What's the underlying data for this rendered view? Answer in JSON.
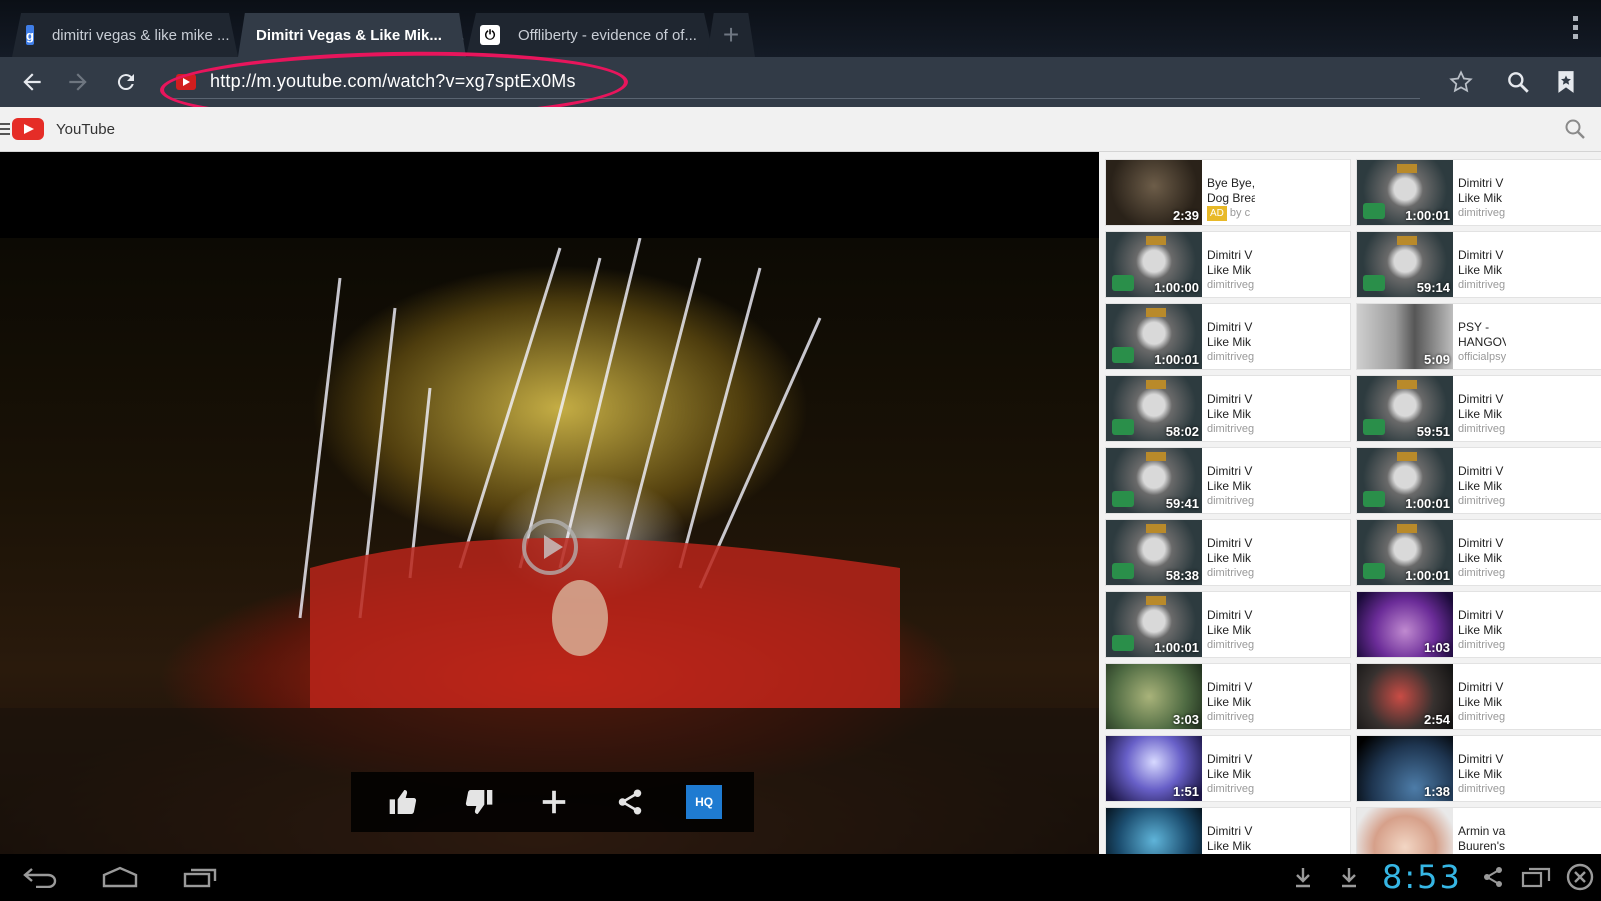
{
  "browser": {
    "tabs": [
      {
        "label": "dimitri vegas & like mike ...",
        "favicon": "google-g-icon",
        "active": false
      },
      {
        "label": "Dimitri Vegas & Like Mik...",
        "favicon": "none",
        "active": true
      },
      {
        "label": "Offliberty - evidence of of...",
        "favicon": "power-icon",
        "active": false
      }
    ],
    "close_glyph": "✕",
    "newtab_glyph": "+",
    "address": "http://m.youtube.com/watch?v=xg7sptEx0Ms",
    "highlight_color": "#e8155c"
  },
  "youtube": {
    "brand": "YouTube",
    "hq_label": "HQ",
    "related": [
      {
        "title": "Bye Bye, Dog Brea",
        "line2": "Dog Brea",
        "channel": "by c",
        "duration": "2:39",
        "ad": "AD",
        "thumb": "pug"
      },
      {
        "title": "Dimitri V",
        "line2": "Like Mik",
        "channel": "dimitriveg",
        "duration": "1:00:01",
        "thumb": "dimitri"
      },
      {
        "title": "Dimitri V",
        "line2": "Like Mik",
        "channel": "dimitriveg",
        "duration": "1:00:00",
        "thumb": "dimitri"
      },
      {
        "title": "Dimitri V",
        "line2": "Like Mik",
        "channel": "dimitriveg",
        "duration": "59:14",
        "thumb": "dimitri"
      },
      {
        "title": "Dimitri V",
        "line2": "Like Mik",
        "channel": "dimitriveg",
        "duration": "1:00:01",
        "thumb": "dimitri"
      },
      {
        "title": "PSY -",
        "line2": "HANGOV",
        "channel": "officialpsy",
        "duration": "5:09",
        "thumb": "psy"
      },
      {
        "title": "Dimitri V",
        "line2": "Like Mik",
        "channel": "dimitriveg",
        "duration": "58:02",
        "thumb": "dimitri"
      },
      {
        "title": "Dimitri V",
        "line2": "Like Mik",
        "channel": "dimitriveg",
        "duration": "59:51",
        "thumb": "dimitri"
      },
      {
        "title": "Dimitri V",
        "line2": "Like Mik",
        "channel": "dimitriveg",
        "duration": "59:41",
        "thumb": "dimitri"
      },
      {
        "title": "Dimitri V",
        "line2": "Like Mik",
        "channel": "dimitriveg",
        "duration": "1:00:01",
        "thumb": "dimitri"
      },
      {
        "title": "Dimitri V",
        "line2": "Like Mik",
        "channel": "dimitriveg",
        "duration": "58:38",
        "thumb": "dimitri"
      },
      {
        "title": "Dimitri V",
        "line2": "Like Mik",
        "channel": "dimitriveg",
        "duration": "1:00:01",
        "thumb": "dimitri"
      },
      {
        "title": "Dimitri V",
        "line2": "Like Mik",
        "channel": "dimitriveg",
        "duration": "1:00:01",
        "thumb": "dimitri"
      },
      {
        "title": "Dimitri V",
        "line2": "Like Mik",
        "channel": "dimitriveg",
        "duration": "1:03",
        "thumb": "purple"
      },
      {
        "title": "Dimitri V",
        "line2": "Like Mik",
        "channel": "dimitriveg",
        "duration": "3:03",
        "thumb": "green"
      },
      {
        "title": "Dimitri V",
        "line2": "Like Mik",
        "channel": "dimitriveg",
        "duration": "2:54",
        "thumb": "tv"
      },
      {
        "title": "Dimitri V",
        "line2": "Like Mik",
        "channel": "dimitriveg",
        "duration": "1:51",
        "thumb": "concert"
      },
      {
        "title": "Dimitri V",
        "line2": "Like Mik",
        "channel": "dimitriveg",
        "duration": "1:38",
        "thumb": "earth"
      },
      {
        "title": "Dimitri V",
        "line2": "Like Mik",
        "channel": "",
        "duration": "",
        "thumb": "blue"
      },
      {
        "title": "Armin va",
        "line2": "Buuren's",
        "channel": "",
        "duration": "",
        "thumb": "armin"
      }
    ]
  },
  "system": {
    "clock": "8:53",
    "clock_color": "#36b6e4"
  }
}
